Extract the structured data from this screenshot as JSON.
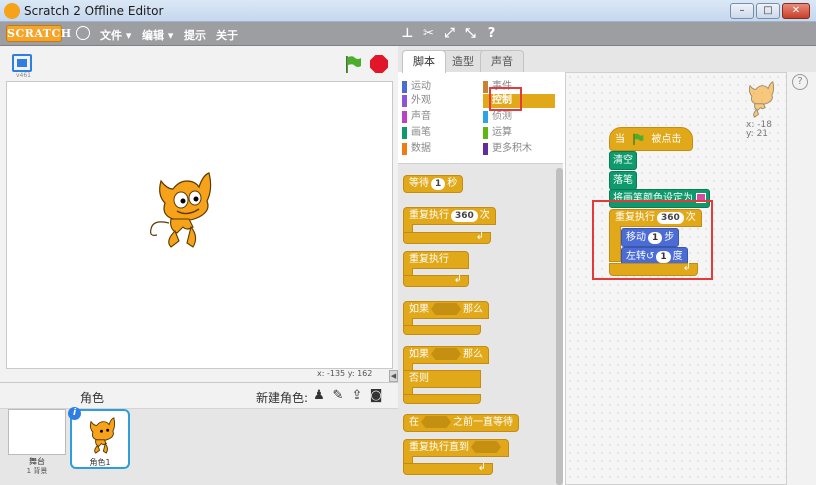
{
  "window": {
    "title": "Scratch 2 Offline Editor"
  },
  "menubar": {
    "logo": "SCRATCH",
    "items": [
      "文件 ▾",
      "编辑 ▾",
      "提示",
      "关于"
    ]
  },
  "stage": {
    "version": "v461",
    "coords_x_label": "x:",
    "coords_x": "-135",
    "coords_y_label": "y:",
    "coords_y": "162"
  },
  "sprites": {
    "header_label": "角色",
    "new_sprite_label": "新建角色:",
    "stage_label": "舞台",
    "stage_backdrops": "1 背景",
    "sprite_name": "角色1"
  },
  "tabs": [
    "脚本",
    "造型",
    "声音"
  ],
  "categories": [
    {
      "label": "运动",
      "color": "#4a6cd4"
    },
    {
      "label": "事件",
      "color": "#c88330"
    },
    {
      "label": "外观",
      "color": "#8a55d7"
    },
    {
      "label": "控制",
      "color": "#e1a91a",
      "selected": true
    },
    {
      "label": "声音",
      "color": "#bb42c3"
    },
    {
      "label": "侦测",
      "color": "#2ca5e2"
    },
    {
      "label": "画笔",
      "color": "#0e9a6c"
    },
    {
      "label": "运算",
      "color": "#5cb712"
    },
    {
      "label": "数据",
      "color": "#ee7d16"
    },
    {
      "label": "更多积木",
      "color": "#632d99"
    }
  ],
  "palette_blocks": {
    "wait": {
      "pre": "等待",
      "value": "1",
      "post": "秒"
    },
    "repeat": {
      "pre": "重复执行",
      "value": "360",
      "post": "次"
    },
    "forever": {
      "label": "重复执行"
    },
    "if_then": {
      "pre": "如果",
      "post": "那么"
    },
    "if_else": {
      "pre": "如果",
      "post": "那么",
      "else": "否则"
    },
    "wait_until": {
      "pre": "在",
      "post": "之前一直等待"
    },
    "repeat_until": {
      "pre": "重复执行直到"
    }
  },
  "script": {
    "hat": {
      "pre": "当",
      "post": "被点击"
    },
    "clear": "清空",
    "pen_down": "落笔",
    "set_pen_color": "将画笔颜色设定为",
    "repeat": {
      "pre": "重复执行",
      "value": "360",
      "post": "次"
    },
    "move": {
      "pre": "移动",
      "value": "1",
      "post": "步"
    },
    "turn": {
      "pre": "左转",
      "icon": "↺",
      "value": "1",
      "post": "度"
    },
    "sprite_x": "x: -18",
    "sprite_y": "y: 21"
  },
  "colors": {
    "control": "#e1a91a",
    "pen": "#0e9a6c",
    "motion": "#4a6cd4",
    "highlight": "#e13b3b"
  }
}
